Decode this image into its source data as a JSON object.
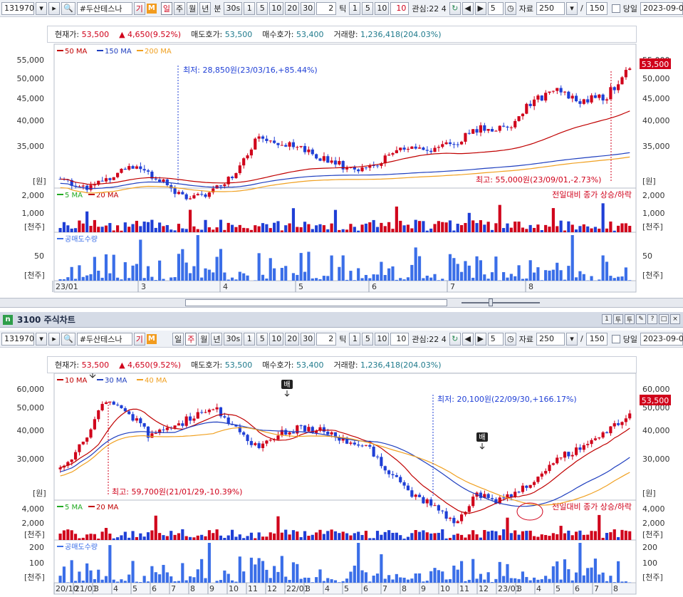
{
  "toolbar": {
    "code": "131970",
    "name": "#두산테스나",
    "gi_label": "기",
    "m_label": "M",
    "periods": [
      "일",
      "주",
      "월",
      "년",
      "분"
    ],
    "minute_value": "30",
    "minute_suffix": "s",
    "nums": [
      "1",
      "5",
      "10",
      "20",
      "30"
    ],
    "tick_count": "2",
    "tick_label": "틱",
    "tick_nums": [
      "1",
      "5",
      "10"
    ],
    "tick_input": "10",
    "interest_label": "관심:22 4",
    "step_value": "5",
    "data_label": "자료",
    "data_count": "250",
    "slash": "/",
    "total_count": "150",
    "today_label": "당일",
    "date": "2023-09-0"
  },
  "info": {
    "price_label": "현재가:",
    "price": "53,500",
    "change": "4,650(9.52%)",
    "ask_label": "매도호가:",
    "ask": "53,500",
    "bid_label": "매수호가:",
    "bid": "53,400",
    "volume_label": "거래량:",
    "volume": "1,236,418(204.03%)"
  },
  "window": {
    "title": "3100 주식차트",
    "buttons": [
      "1",
      "투",
      "투",
      "✎",
      "?",
      "□",
      "×"
    ]
  },
  "charts": [
    {
      "selected_period": "일",
      "price_ma_legend": [
        "50 MA",
        "150 MA",
        "200 MA"
      ],
      "vol_ma_legend": [
        "5 MA",
        "20 MA"
      ],
      "short_legend": "공매도수량",
      "y_labels": [
        "55,000",
        "50,000",
        "45,000",
        "40,000",
        "35,000"
      ],
      "y_unit": "[원]",
      "vol_labels": [
        "2,000",
        "1,000"
      ],
      "vol_unit": "[천주]",
      "short_labels": [
        "50"
      ],
      "short_unit": "[천주]",
      "x_labels": [
        "23/01",
        "3",
        "4",
        "5",
        "6",
        "7",
        "8"
      ],
      "low_annotation": "최저: 28,850원(23/03/16,+85.44%)",
      "high_annotation": "최고: 55,000원(23/09/01,-2.73%)",
      "vol_note": "전일대비 종가 상승/하락",
      "price_tag": "53,500",
      "price_tag_top": "53,500"
    },
    {
      "selected_period": "주",
      "price_ma_legend": [
        "10 MA",
        "30 MA",
        "40 MA"
      ],
      "vol_ma_legend": [
        "5 MA",
        "20 MA"
      ],
      "short_legend": "공매도수량",
      "y_labels": [
        "60,000",
        "50,000",
        "40,000",
        "30,000"
      ],
      "y_unit": "[원]",
      "vol_labels": [
        "4,000",
        "2,000"
      ],
      "vol_unit": "[천주]",
      "short_labels": [
        "200",
        "100"
      ],
      "short_unit": "[천주]",
      "x_labels": [
        "20/10",
        "21/01",
        "3",
        "4",
        "5",
        "6",
        "7",
        "8",
        "9",
        "10",
        "11",
        "12",
        "22/01",
        "3",
        "4",
        "5",
        "6",
        "7",
        "8",
        "9",
        "10",
        "11",
        "12",
        "23/01",
        "3",
        "4",
        "5",
        "6",
        "7",
        "8"
      ],
      "low_annotation": "최저: 20,100원(22/09/30,+166.17%)",
      "high_annotation": "최고: 59,700원(21/01/29,-10.39%)",
      "vol_note": "전일대비 종가 상승/하락",
      "price_tag": "53,500",
      "sell_marker": "배"
    }
  ],
  "colors": {
    "up": "#d0021b",
    "down": "#1f3fd6",
    "ma_short": "#c00000",
    "ma_mid": "#1f3fbf",
    "ma_long": "#f0a020",
    "short_bar": "#3a6ee8",
    "green": "#22aa22"
  }
}
